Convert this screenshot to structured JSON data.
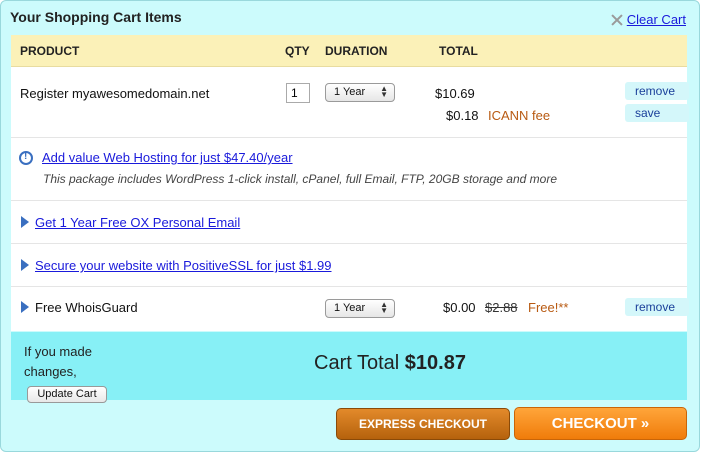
{
  "header": {
    "title": "Your Shopping Cart Items",
    "clear_cart": "Clear Cart"
  },
  "columns": {
    "product": "PRODUCT",
    "qty": "QTY",
    "duration": "DURATION",
    "total": "TOTAL"
  },
  "items": [
    {
      "product": "Register myawesomedomain.net",
      "qty": "1",
      "duration": "1 Year",
      "price": "$10.69",
      "fee_amount": "$0.18",
      "fee_label": "ICANN fee",
      "actions": [
        "remove",
        "save"
      ]
    },
    {
      "product": "Free WhoisGuard",
      "duration": "1 Year",
      "price": "$0.00",
      "original_price": "$2.88",
      "free_label": "Free!**",
      "actions": [
        "remove"
      ]
    }
  ],
  "offers": {
    "hosting": {
      "link": "Add value Web Hosting for just $47.40/year",
      "description": "This package includes WordPress 1-click install, cPanel, full Email, FTP, 20GB storage and more"
    },
    "email": "Get 1 Year Free OX Personal Email",
    "ssl": "Secure your website with PositiveSSL for just $1.99"
  },
  "footer": {
    "changes_text": "If you made changes,",
    "update_button": "Update Cart",
    "total_label": "Cart Total",
    "total_value": "$10.87"
  },
  "buttons": {
    "express_checkout": "EXPRESS CHECKOUT",
    "checkout": "CHECKOUT »"
  },
  "colors": {
    "background": "#ccfbfc",
    "header_row": "#fbf1b8",
    "footer": "#87f0f6",
    "link": "#1a1adb",
    "accent_orange": "#f07c0a"
  }
}
